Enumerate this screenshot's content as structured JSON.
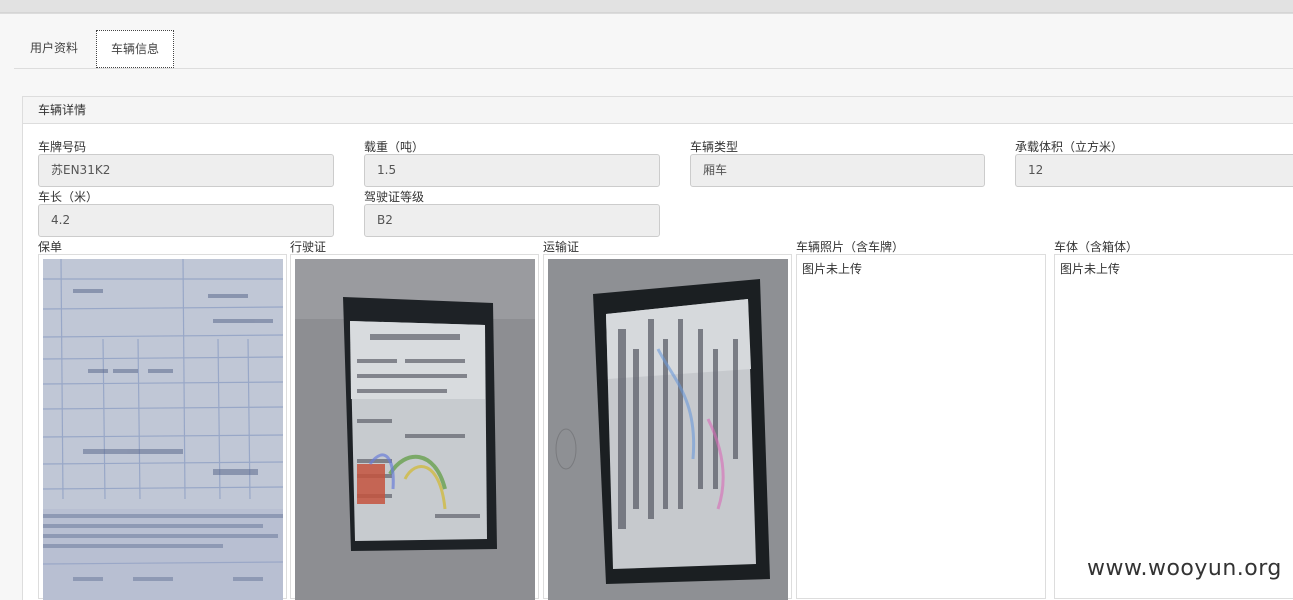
{
  "tabs": [
    {
      "label": "用户资料"
    },
    {
      "label": "车辆信息"
    }
  ],
  "panel": {
    "title": "车辆详情"
  },
  "fields": {
    "plate": {
      "label": "车牌号码",
      "value": "苏EN31K2"
    },
    "load": {
      "label": "载重（吨）",
      "value": "1.5"
    },
    "vehicle_type": {
      "label": "车辆类型",
      "value": "厢车"
    },
    "volume": {
      "label": "承载体积（立方米）",
      "value": "12"
    },
    "length": {
      "label": "车长（米）",
      "value": "4.2"
    },
    "license_grade": {
      "label": "驾驶证等级",
      "value": "B2"
    }
  },
  "images": {
    "insurance": {
      "label": "保单"
    },
    "driving_license": {
      "label": "行驶证"
    },
    "transport_permit": {
      "label": "运输证"
    },
    "vehicle_photo": {
      "label": "车辆照片（含车牌）",
      "empty_text": "图片未上传"
    },
    "body_photo": {
      "label": "车体（含箱体）",
      "empty_text": "图片未上传"
    }
  },
  "watermark": "www.wooyun.org",
  "colors": {
    "field_bg": "#eeeeee",
    "border": "#dddddd",
    "panel_head_bg": "#f5f5f5"
  }
}
